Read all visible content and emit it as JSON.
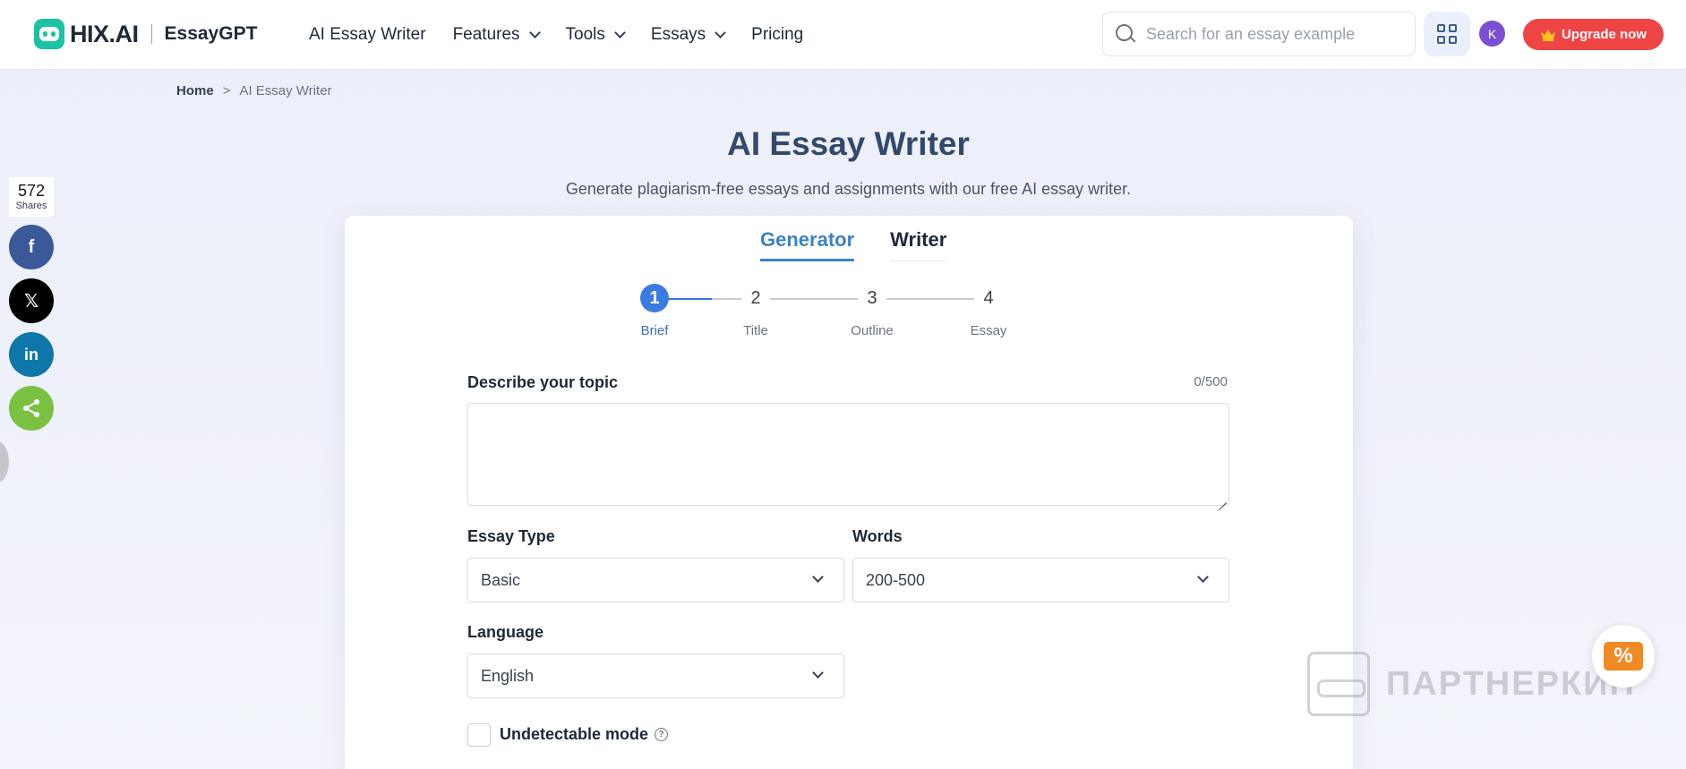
{
  "header": {
    "logo_text": "HIX.AI",
    "logo_sub": "EssayGPT",
    "nav": [
      {
        "label": "AI Essay Writer"
      },
      {
        "label": "Features"
      },
      {
        "label": "Tools"
      },
      {
        "label": "Essays"
      },
      {
        "label": "Pricing"
      }
    ],
    "search_placeholder": "Search for an essay example",
    "avatar_initial": "K",
    "upgrade_label": "Upgrade now"
  },
  "breadcrumb": {
    "home": "Home",
    "separator": ">",
    "current": "AI Essay Writer"
  },
  "title": "AI Essay Writer",
  "subtitle": "Generate plagiarism-free essays and assignments with our free AI essay writer.",
  "share": {
    "count": "572",
    "count_label": "Shares",
    "facebook_glyph": "f",
    "x_glyph": "𝕏",
    "linkedin_glyph": "in"
  },
  "tabs": [
    {
      "label": "Generator",
      "active": true
    },
    {
      "label": "Writer",
      "active": false
    }
  ],
  "steps": [
    {
      "num": "1",
      "label": "Brief"
    },
    {
      "num": "2",
      "label": "Title"
    },
    {
      "num": "3",
      "label": "Outline"
    },
    {
      "num": "4",
      "label": "Essay"
    }
  ],
  "form": {
    "topic_label": "Describe your topic",
    "topic_counter": "0/500",
    "essay_type_label": "Essay Type",
    "essay_type_value": "Basic",
    "words_label": "Words",
    "words_value": "200-500",
    "language_label": "Language",
    "language_value": "English",
    "undetectable_label": "Undetectable mode",
    "help_glyph": "?"
  },
  "promo_glyph": "%",
  "watermark": "ПАРТНЕРКИН",
  "colors": {
    "accent": "#3b82c4",
    "brand": "#19c3a4",
    "upgrade": "#ef4444"
  }
}
